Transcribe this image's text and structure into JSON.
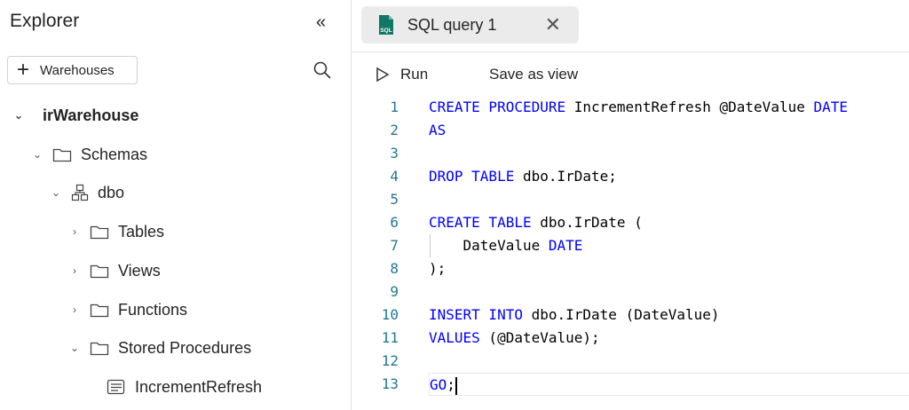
{
  "sidebar": {
    "title": "Explorer",
    "add_label": "Warehouses",
    "tree": [
      "irWarehouse",
      "Schemas",
      "dbo",
      "Tables",
      "Views",
      "Functions",
      "Stored Procedures",
      "IncrementRefresh"
    ]
  },
  "tab": {
    "label": "SQL query 1",
    "icon_text": "SQL"
  },
  "toolbar": {
    "run": "Run",
    "save_view": "Save as view"
  },
  "code": {
    "line_numbers": [
      "1",
      "2",
      "3",
      "4",
      "5",
      "6",
      "7",
      "8",
      "9",
      "10",
      "11",
      "12",
      "13"
    ],
    "lines": [
      [
        {
          "k": 1,
          "t": "CREATE PROCEDURE"
        },
        {
          "k": 0,
          "t": " IncrementRefresh @DateValue "
        },
        {
          "k": 1,
          "t": "DATE"
        }
      ],
      [
        {
          "k": 1,
          "t": "AS"
        }
      ],
      [],
      [
        {
          "k": 1,
          "t": "DROP TABLE"
        },
        {
          "k": 0,
          "t": " dbo.IrDate;"
        }
      ],
      [],
      [
        {
          "k": 1,
          "t": "CREATE TABLE"
        },
        {
          "k": 0,
          "t": " dbo.IrDate ("
        }
      ],
      [
        {
          "k": 0,
          "t": "    DateValue "
        },
        {
          "k": 1,
          "t": "DATE"
        }
      ],
      [
        {
          "k": 0,
          "t": ");"
        }
      ],
      [],
      [
        {
          "k": 1,
          "t": "INSERT INTO"
        },
        {
          "k": 0,
          "t": " dbo.IrDate (DateValue)"
        }
      ],
      [
        {
          "k": 1,
          "t": "VALUES"
        },
        {
          "k": 0,
          "t": " (@DateValue);"
        }
      ],
      [],
      [
        {
          "k": 1,
          "t": "GO"
        },
        {
          "k": 0,
          "t": ";"
        }
      ]
    ]
  },
  "colors": {
    "keyword": "#0000ff",
    "line_number": "#237893",
    "sql_icon": "#117865"
  }
}
